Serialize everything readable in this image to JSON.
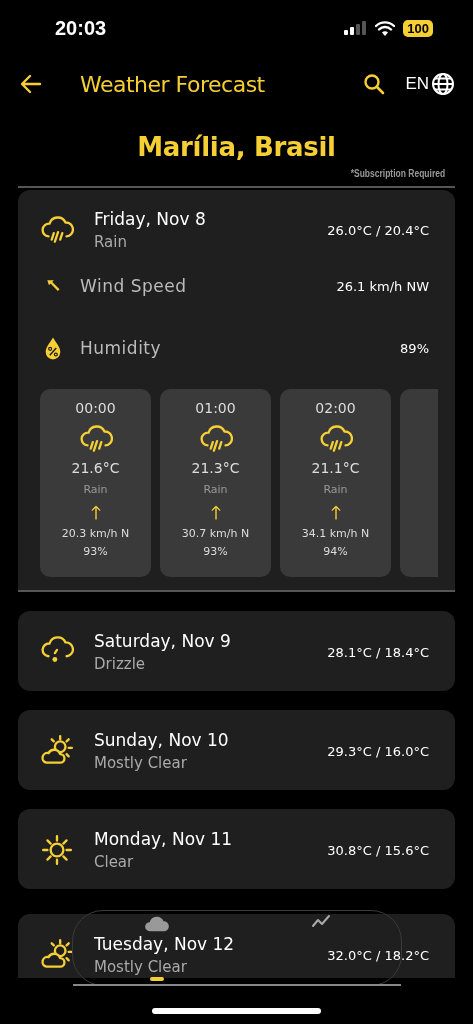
{
  "status_bar": {
    "time": "20:03",
    "battery": "100"
  },
  "header": {
    "title": "Weather Forecast",
    "language": "EN"
  },
  "location": {
    "city": "Marília, Brasil",
    "note": "*Subscription Required"
  },
  "days": [
    {
      "date": "Friday, Nov 8",
      "condition": "Rain",
      "kind": "rain",
      "temps": "26.0°C / 20.4°C",
      "expanded": true,
      "details": [
        {
          "kind": "wind",
          "label": "Wind Speed",
          "value": "26.1 km/h NW"
        },
        {
          "kind": "humidity",
          "label": "Humidity",
          "value": "89%"
        }
      ],
      "hours": [
        {
          "time": "00:00",
          "kind": "rain",
          "temp": "21.6°C",
          "condition": "Rain",
          "wind": "20.3 km/h N",
          "humidity": "93%"
        },
        {
          "time": "01:00",
          "kind": "rain",
          "temp": "21.3°C",
          "condition": "Rain",
          "wind": "30.7 km/h N",
          "humidity": "93%"
        },
        {
          "time": "02:00",
          "kind": "rain",
          "temp": "21.1°C",
          "condition": "Rain",
          "wind": "34.1 km/h N",
          "humidity": "94%"
        }
      ]
    },
    {
      "date": "Saturday, Nov 9",
      "condition": "Drizzle",
      "kind": "drizzle",
      "temps": "28.1°C / 18.4°C",
      "expanded": false
    },
    {
      "date": "Sunday, Nov 10",
      "condition": "Mostly Clear",
      "kind": "partly",
      "temps": "29.3°C / 16.0°C",
      "expanded": false
    },
    {
      "date": "Monday, Nov 11",
      "condition": "Clear",
      "kind": "sun",
      "temps": "30.8°C / 15.6°C",
      "expanded": false
    },
    {
      "date": "Tuesday, Nov 12",
      "condition": "Mostly Clear",
      "kind": "partly",
      "temps": "32.0°C / 18.2°C",
      "expanded": false
    }
  ],
  "nav": [
    {
      "kind": "forecast",
      "selected": true
    },
    {
      "kind": "chart",
      "selected": false
    }
  ]
}
